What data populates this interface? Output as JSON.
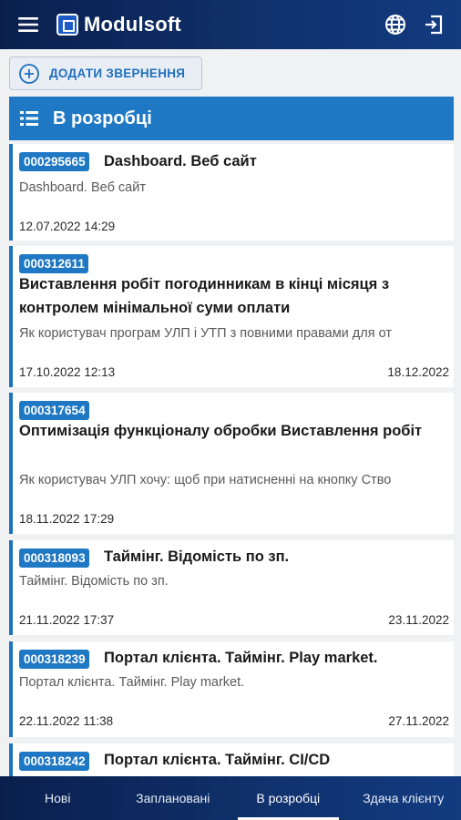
{
  "app": {
    "name": "Modulsoft"
  },
  "header": {
    "menu_icon": "hamburger-menu-icon",
    "lang_icon": "globe-icon",
    "logout_icon": "logout-icon"
  },
  "add_button": {
    "label": "ДОДАТИ ЗВЕРНЕННЯ",
    "icon": "plus-circle-icon"
  },
  "section": {
    "title": "В розробці",
    "icon": "list-icon"
  },
  "cards": [
    {
      "id": "000295665",
      "title": "Dashboard. Веб сайт",
      "desc": "Dashboard. Веб сайт",
      "created": "12.07.2022 14:29",
      "due": ""
    },
    {
      "id": "000312611",
      "title": "Виставлення робіт погодинникам в кінці місяця з контролем мінімальної суми оплати",
      "desc": "Як користувач програм УЛП і УТП з повними правами для от",
      "created": "17.10.2022 12:13",
      "due": "18.12.2022"
    },
    {
      "id": "000317654",
      "title": "Оптимізація функціоналу обробки Виставлення робіт",
      "desc": "Як користувач УЛП хочу: щоб при натисненні на кнопку Ство",
      "created": "18.11.2022 17:29",
      "due": ""
    },
    {
      "id": "000318093",
      "title": "Таймінг. Відомість по зп.",
      "desc": "Таймінг. Відомість по зп.",
      "created": "21.11.2022 17:37",
      "due": "23.11.2022"
    },
    {
      "id": "000318239",
      "title": "Портал клієнта. Таймінг. Play market.",
      "desc": "Портал клієнта. Таймінг. Play market.",
      "created": "22.11.2022 11:38",
      "due": "27.11.2022"
    },
    {
      "id": "000318242",
      "title": "Портал клієнта. Таймінг. CI/CD",
      "desc": "",
      "created": "",
      "due": ""
    }
  ],
  "tabs": [
    {
      "label": "Нові",
      "active": false
    },
    {
      "label": "Заплановані",
      "active": false
    },
    {
      "label": "В розробці",
      "active": true
    },
    {
      "label": "Здача клієнту",
      "active": false
    }
  ]
}
